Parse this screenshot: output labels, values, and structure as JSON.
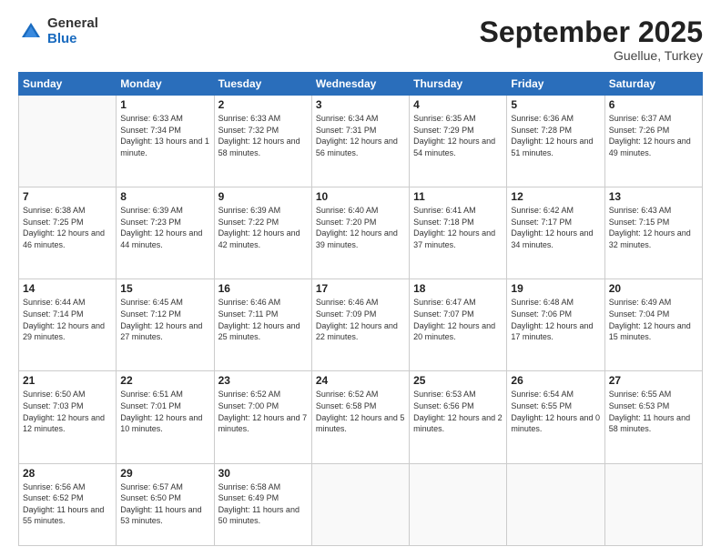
{
  "logo": {
    "general": "General",
    "blue": "Blue"
  },
  "header": {
    "month": "September 2025",
    "location": "Guellue, Turkey"
  },
  "weekdays": [
    "Sunday",
    "Monday",
    "Tuesday",
    "Wednesday",
    "Thursday",
    "Friday",
    "Saturday"
  ],
  "weeks": [
    [
      {
        "day": "",
        "sunrise": "",
        "sunset": "",
        "daylight": ""
      },
      {
        "day": "1",
        "sunrise": "Sunrise: 6:33 AM",
        "sunset": "Sunset: 7:34 PM",
        "daylight": "Daylight: 13 hours and 1 minute."
      },
      {
        "day": "2",
        "sunrise": "Sunrise: 6:33 AM",
        "sunset": "Sunset: 7:32 PM",
        "daylight": "Daylight: 12 hours and 58 minutes."
      },
      {
        "day": "3",
        "sunrise": "Sunrise: 6:34 AM",
        "sunset": "Sunset: 7:31 PM",
        "daylight": "Daylight: 12 hours and 56 minutes."
      },
      {
        "day": "4",
        "sunrise": "Sunrise: 6:35 AM",
        "sunset": "Sunset: 7:29 PM",
        "daylight": "Daylight: 12 hours and 54 minutes."
      },
      {
        "day": "5",
        "sunrise": "Sunrise: 6:36 AM",
        "sunset": "Sunset: 7:28 PM",
        "daylight": "Daylight: 12 hours and 51 minutes."
      },
      {
        "day": "6",
        "sunrise": "Sunrise: 6:37 AM",
        "sunset": "Sunset: 7:26 PM",
        "daylight": "Daylight: 12 hours and 49 minutes."
      }
    ],
    [
      {
        "day": "7",
        "sunrise": "Sunrise: 6:38 AM",
        "sunset": "Sunset: 7:25 PM",
        "daylight": "Daylight: 12 hours and 46 minutes."
      },
      {
        "day": "8",
        "sunrise": "Sunrise: 6:39 AM",
        "sunset": "Sunset: 7:23 PM",
        "daylight": "Daylight: 12 hours and 44 minutes."
      },
      {
        "day": "9",
        "sunrise": "Sunrise: 6:39 AM",
        "sunset": "Sunset: 7:22 PM",
        "daylight": "Daylight: 12 hours and 42 minutes."
      },
      {
        "day": "10",
        "sunrise": "Sunrise: 6:40 AM",
        "sunset": "Sunset: 7:20 PM",
        "daylight": "Daylight: 12 hours and 39 minutes."
      },
      {
        "day": "11",
        "sunrise": "Sunrise: 6:41 AM",
        "sunset": "Sunset: 7:18 PM",
        "daylight": "Daylight: 12 hours and 37 minutes."
      },
      {
        "day": "12",
        "sunrise": "Sunrise: 6:42 AM",
        "sunset": "Sunset: 7:17 PM",
        "daylight": "Daylight: 12 hours and 34 minutes."
      },
      {
        "day": "13",
        "sunrise": "Sunrise: 6:43 AM",
        "sunset": "Sunset: 7:15 PM",
        "daylight": "Daylight: 12 hours and 32 minutes."
      }
    ],
    [
      {
        "day": "14",
        "sunrise": "Sunrise: 6:44 AM",
        "sunset": "Sunset: 7:14 PM",
        "daylight": "Daylight: 12 hours and 29 minutes."
      },
      {
        "day": "15",
        "sunrise": "Sunrise: 6:45 AM",
        "sunset": "Sunset: 7:12 PM",
        "daylight": "Daylight: 12 hours and 27 minutes."
      },
      {
        "day": "16",
        "sunrise": "Sunrise: 6:46 AM",
        "sunset": "Sunset: 7:11 PM",
        "daylight": "Daylight: 12 hours and 25 minutes."
      },
      {
        "day": "17",
        "sunrise": "Sunrise: 6:46 AM",
        "sunset": "Sunset: 7:09 PM",
        "daylight": "Daylight: 12 hours and 22 minutes."
      },
      {
        "day": "18",
        "sunrise": "Sunrise: 6:47 AM",
        "sunset": "Sunset: 7:07 PM",
        "daylight": "Daylight: 12 hours and 20 minutes."
      },
      {
        "day": "19",
        "sunrise": "Sunrise: 6:48 AM",
        "sunset": "Sunset: 7:06 PM",
        "daylight": "Daylight: 12 hours and 17 minutes."
      },
      {
        "day": "20",
        "sunrise": "Sunrise: 6:49 AM",
        "sunset": "Sunset: 7:04 PM",
        "daylight": "Daylight: 12 hours and 15 minutes."
      }
    ],
    [
      {
        "day": "21",
        "sunrise": "Sunrise: 6:50 AM",
        "sunset": "Sunset: 7:03 PM",
        "daylight": "Daylight: 12 hours and 12 minutes."
      },
      {
        "day": "22",
        "sunrise": "Sunrise: 6:51 AM",
        "sunset": "Sunset: 7:01 PM",
        "daylight": "Daylight: 12 hours and 10 minutes."
      },
      {
        "day": "23",
        "sunrise": "Sunrise: 6:52 AM",
        "sunset": "Sunset: 7:00 PM",
        "daylight": "Daylight: 12 hours and 7 minutes."
      },
      {
        "day": "24",
        "sunrise": "Sunrise: 6:52 AM",
        "sunset": "Sunset: 6:58 PM",
        "daylight": "Daylight: 12 hours and 5 minutes."
      },
      {
        "day": "25",
        "sunrise": "Sunrise: 6:53 AM",
        "sunset": "Sunset: 6:56 PM",
        "daylight": "Daylight: 12 hours and 2 minutes."
      },
      {
        "day": "26",
        "sunrise": "Sunrise: 6:54 AM",
        "sunset": "Sunset: 6:55 PM",
        "daylight": "Daylight: 12 hours and 0 minutes."
      },
      {
        "day": "27",
        "sunrise": "Sunrise: 6:55 AM",
        "sunset": "Sunset: 6:53 PM",
        "daylight": "Daylight: 11 hours and 58 minutes."
      }
    ],
    [
      {
        "day": "28",
        "sunrise": "Sunrise: 6:56 AM",
        "sunset": "Sunset: 6:52 PM",
        "daylight": "Daylight: 11 hours and 55 minutes."
      },
      {
        "day": "29",
        "sunrise": "Sunrise: 6:57 AM",
        "sunset": "Sunset: 6:50 PM",
        "daylight": "Daylight: 11 hours and 53 minutes."
      },
      {
        "day": "30",
        "sunrise": "Sunrise: 6:58 AM",
        "sunset": "Sunset: 6:49 PM",
        "daylight": "Daylight: 11 hours and 50 minutes."
      },
      {
        "day": "",
        "sunrise": "",
        "sunset": "",
        "daylight": ""
      },
      {
        "day": "",
        "sunrise": "",
        "sunset": "",
        "daylight": ""
      },
      {
        "day": "",
        "sunrise": "",
        "sunset": "",
        "daylight": ""
      },
      {
        "day": "",
        "sunrise": "",
        "sunset": "",
        "daylight": ""
      }
    ]
  ]
}
